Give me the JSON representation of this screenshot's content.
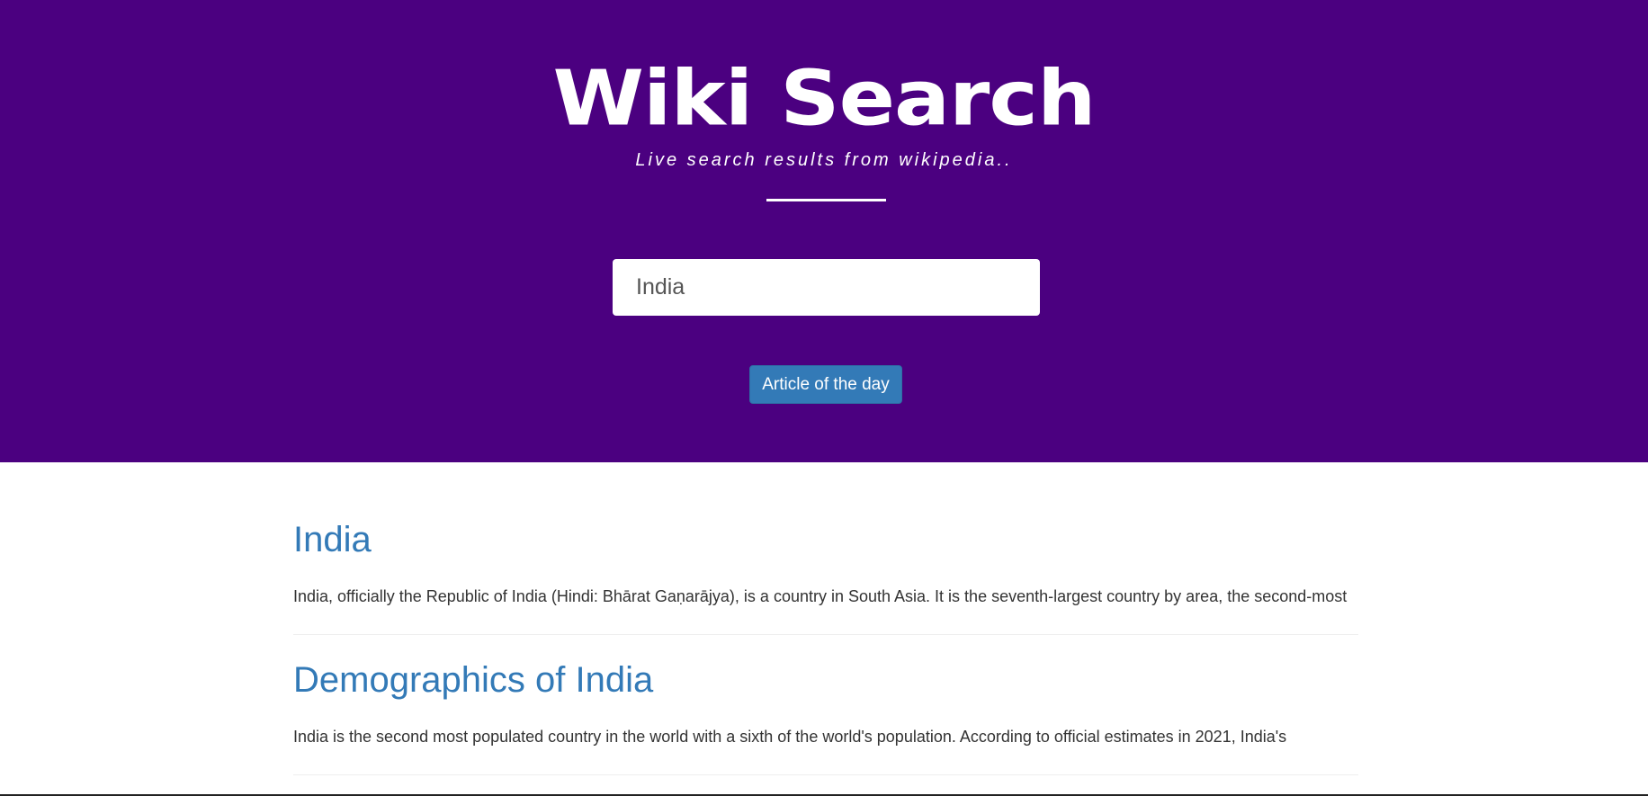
{
  "header": {
    "title": "Wiki Search",
    "subtitle": "Live search results from wikipedia.."
  },
  "search": {
    "value": "India"
  },
  "buttons": {
    "article_of_the_day": "Article of the day"
  },
  "results": [
    {
      "title": "India",
      "snippet": "India, officially the Republic of India (Hindi: Bhārat Gaṇarājya), is a country in South Asia. It is the seventh-largest country by area, the second-most"
    },
    {
      "title": "Demographics of India",
      "snippet": "India is the second most populated country in the world with a sixth of the world's population. According to official estimates in 2021, India's"
    }
  ],
  "colors": {
    "hero_background": "#4b0080",
    "link": "#337ab7",
    "button": "#337ab7"
  }
}
